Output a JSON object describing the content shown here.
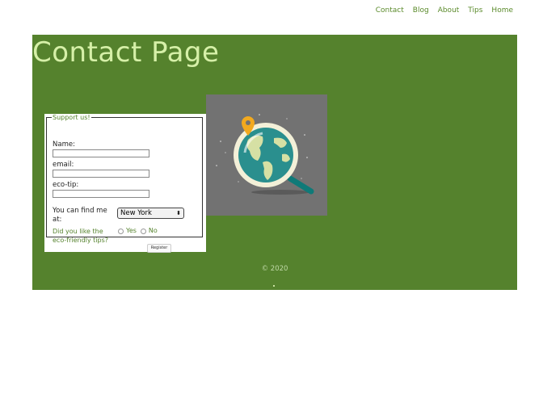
{
  "nav": {
    "items": [
      "Contact",
      "Blog",
      "About",
      "Tips",
      "Home"
    ]
  },
  "page": {
    "title": "Contact Page"
  },
  "form": {
    "legend": "Support us!",
    "name_label": "Name:",
    "email_label": "email:",
    "tip_label": "eco-tip:",
    "name_value": "",
    "email_value": "",
    "tip_value": "",
    "location_label": "You can find me at:",
    "location_selected": "New York",
    "question": "Did you like the eco-friendly tips?",
    "option_yes": "Yes",
    "option_no": "No",
    "register_label": "Register"
  },
  "footer": {
    "copyright": "© 2020"
  },
  "colors": {
    "main_bg": "#55822d",
    "title": "#d6f0a8",
    "nav_link": "#5a8a2a",
    "image_bg": "#727272"
  },
  "image": {
    "icon": "globe-magnifier-icon"
  }
}
